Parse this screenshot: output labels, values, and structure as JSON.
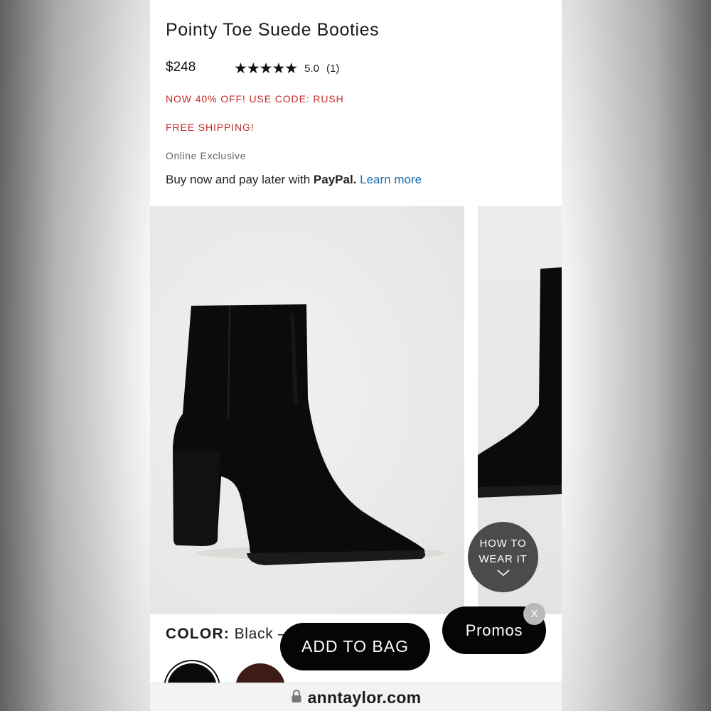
{
  "product": {
    "title": "Pointy Toe Suede Booties",
    "price": "$248",
    "stars": "★★★★★",
    "rating": "5.0",
    "review_count": "(1)",
    "promo_discount": "NOW 40% OFF! USE CODE: RUSH",
    "promo_shipping": "FREE SHIPPING!",
    "availability": "Online Exclusive"
  },
  "paypal": {
    "prefix": "Buy now and pay later with ",
    "brand": "PayPal.",
    "link": "Learn more"
  },
  "gallery": {
    "how_to_wear_line1": "HOW TO",
    "how_to_wear_line2": "WEAR IT"
  },
  "color": {
    "label": "COLOR:",
    "value": "Black –",
    "swatches": [
      "black",
      "brown"
    ]
  },
  "actions": {
    "add_to_bag": "ADD TO BAG",
    "promos": "Promos",
    "close": "X"
  },
  "browser": {
    "url": "anntaylor.com"
  },
  "colors": {
    "promo_red": "#c32a2a",
    "link_blue": "#1b6db3",
    "button_black": "#050505"
  }
}
